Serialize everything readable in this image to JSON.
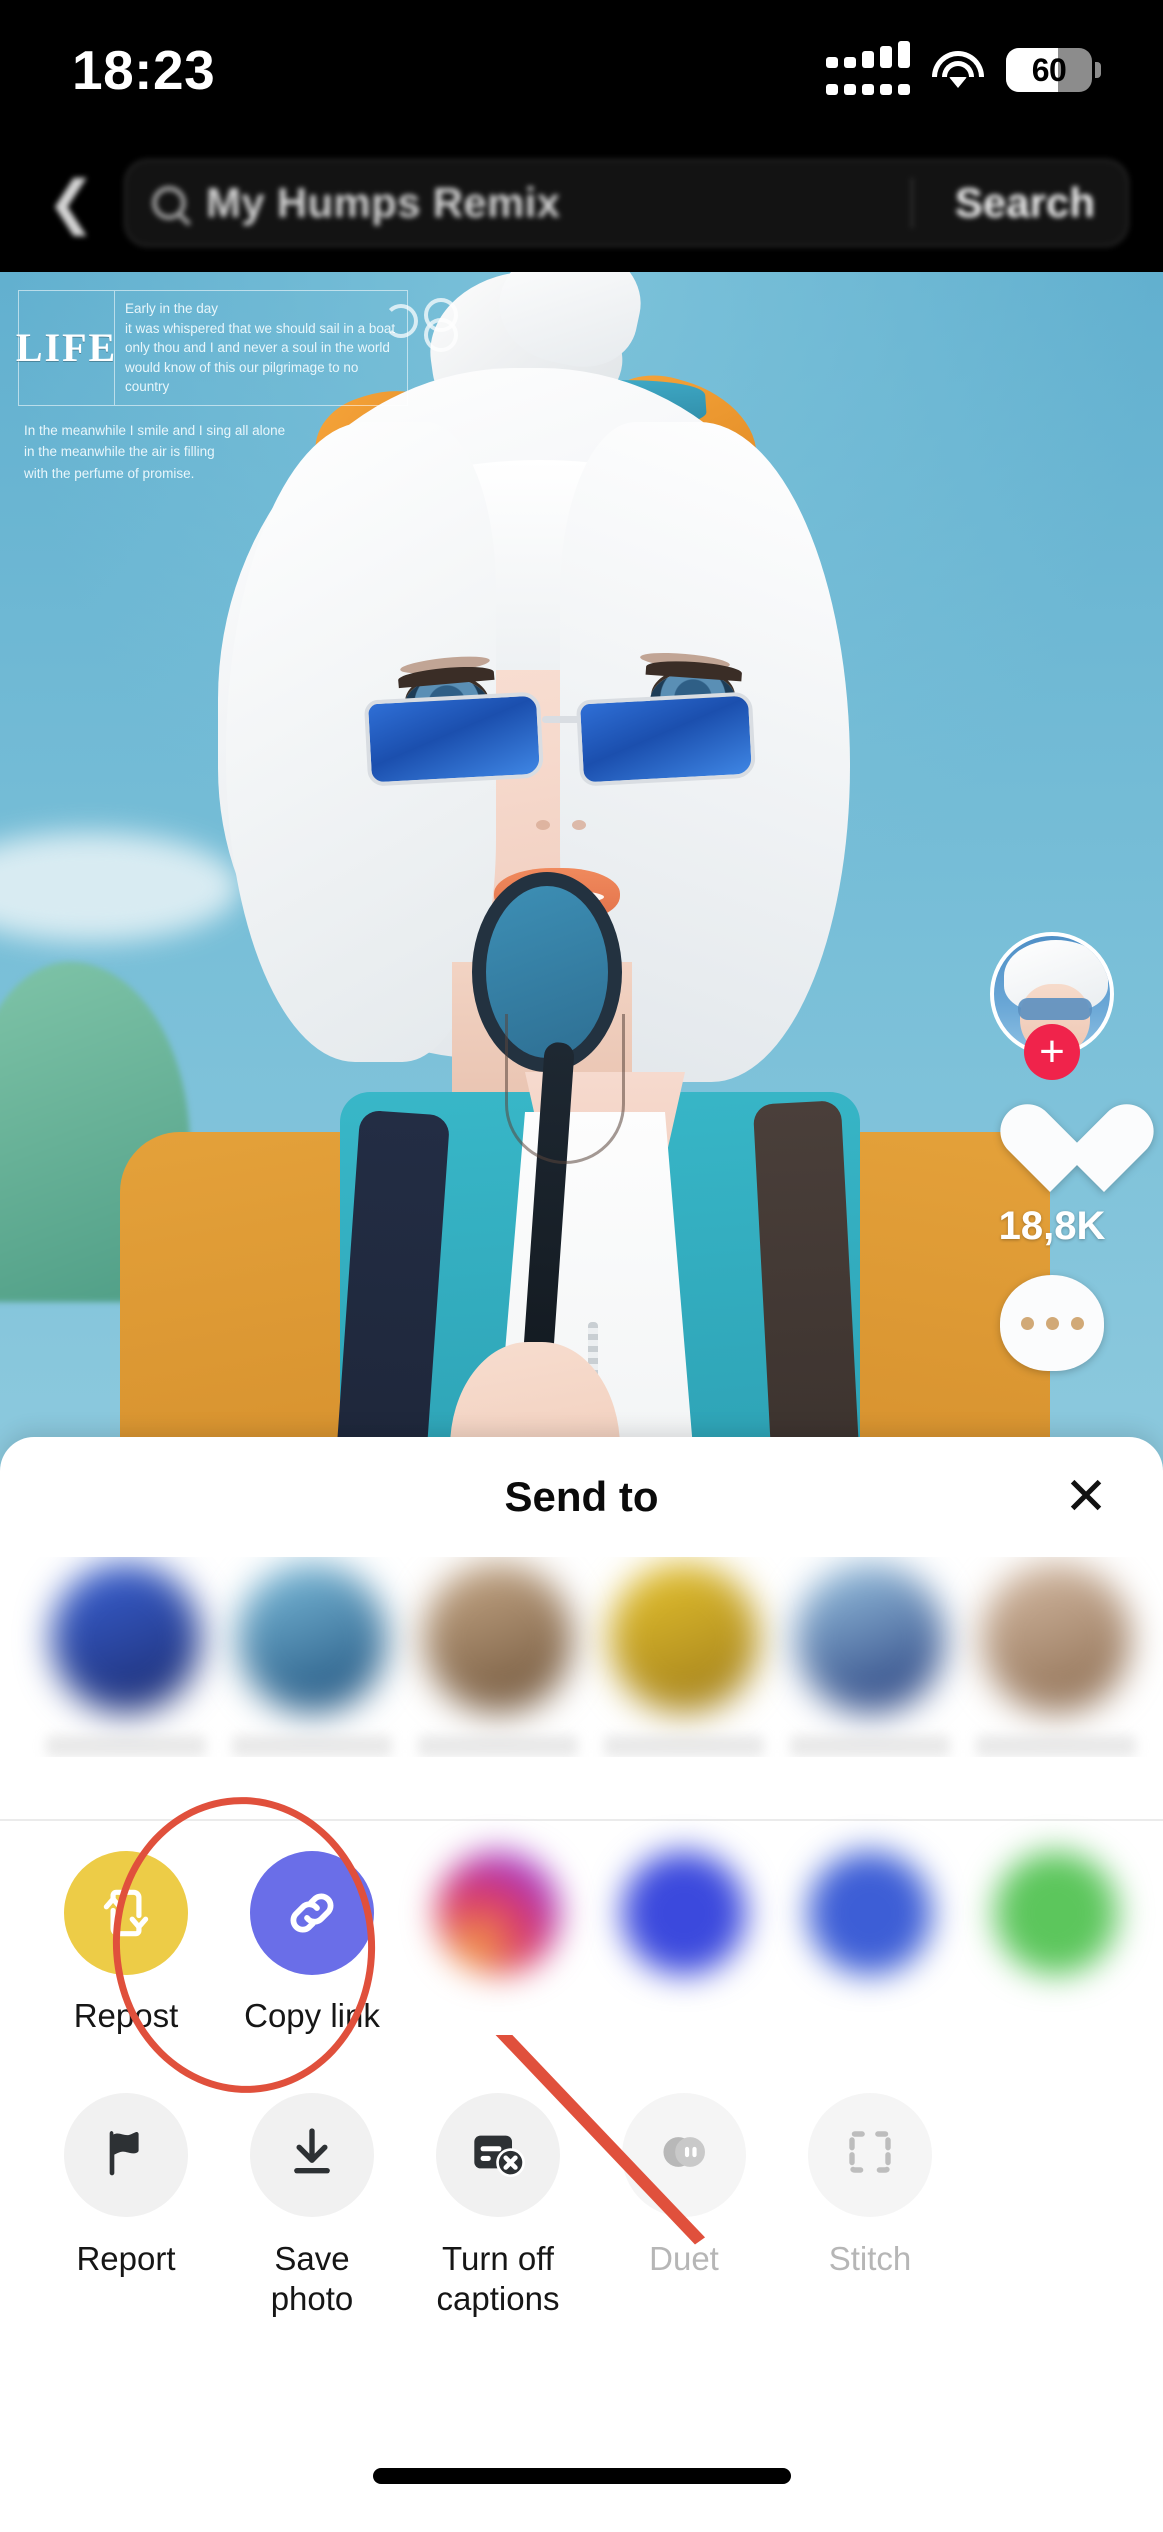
{
  "status_bar": {
    "time": "18:23",
    "battery_level": "60",
    "battery_percent": 60,
    "wifi_icon": "wifi-icon",
    "signal_icon": "cellular-signal-icon"
  },
  "search_header": {
    "back_icon": "back-chevron-icon",
    "search_icon": "search-icon",
    "query": "My Humps Remix",
    "search_button_label": "Search"
  },
  "video": {
    "lyric_overlay": {
      "badge": "LIFE",
      "lines": [
        "Early in the day",
        "it was whispered that we should sail in a boat",
        "only thou and I and never a soul in the world",
        "would know of this our pilgrimage to no country"
      ],
      "sub_lines": [
        "In the meanwhile I smile and I sing all alone",
        "in the meanwhile the air is filling",
        "with the perfume of promise."
      ]
    },
    "rail": {
      "avatar_name": "avatar",
      "follow_icon": "plus-icon",
      "like_icon": "heart-icon",
      "like_count": "18,8K",
      "comment_icon": "comment-bubble-icon"
    }
  },
  "share_sheet": {
    "title": "Send to",
    "close_icon": "close-icon",
    "contacts": [
      {
        "name": "",
        "color1": "#3a63d8",
        "color2": "#1b2a6b"
      },
      {
        "name": "",
        "color1": "#7fc0de",
        "color2": "#1d4e7a"
      },
      {
        "name": "",
        "color1": "#c9ab8a",
        "color2": "#6d5238"
      },
      {
        "name": "",
        "color1": "#e8c52e",
        "color2": "#9d7a1b"
      },
      {
        "name": "",
        "color1": "#9dc8e4",
        "color2": "#233a7a"
      },
      {
        "name": "",
        "color1": "#d7bda6",
        "color2": "#8a6a4e"
      }
    ],
    "share_targets": [
      {
        "label": "Repost",
        "icon": "repost-icon",
        "bg": "#edcc47",
        "blurred": false,
        "highlighted": false
      },
      {
        "label": "Copy link",
        "icon": "link-icon",
        "bg": "#6a6ee8",
        "blurred": false,
        "highlighted": true
      },
      {
        "label": "",
        "icon": "instagram-icon",
        "bg": "#c34bbd",
        "blurred": true,
        "highlighted": false
      },
      {
        "label": "",
        "icon": "telegram-icon",
        "bg": "#3b49dd",
        "blurred": true,
        "highlighted": false
      },
      {
        "label": "",
        "icon": "facebook-icon",
        "bg": "#3d5ed6",
        "blurred": true,
        "highlighted": false
      },
      {
        "label": "",
        "icon": "whatsapp-icon",
        "bg": "#5cc65c",
        "blurred": true,
        "highlighted": false
      }
    ],
    "actions": [
      {
        "label": "Report",
        "icon": "flag-icon",
        "disabled": false
      },
      {
        "label": "Save photo",
        "icon": "download-icon",
        "disabled": false
      },
      {
        "label": "Turn off captions",
        "icon": "captions-off-icon",
        "disabled": false
      },
      {
        "label": "Duet",
        "icon": "duet-icon",
        "disabled": true
      },
      {
        "label": "Stitch",
        "icon": "stitch-icon",
        "disabled": true
      }
    ]
  },
  "annotation": {
    "highlight_color": "#e0503c",
    "target_label": "Copy link",
    "arrow_icon": "annotation-arrow-icon",
    "circle_icon": "annotation-circle-icon"
  },
  "home_indicator": "home-indicator"
}
